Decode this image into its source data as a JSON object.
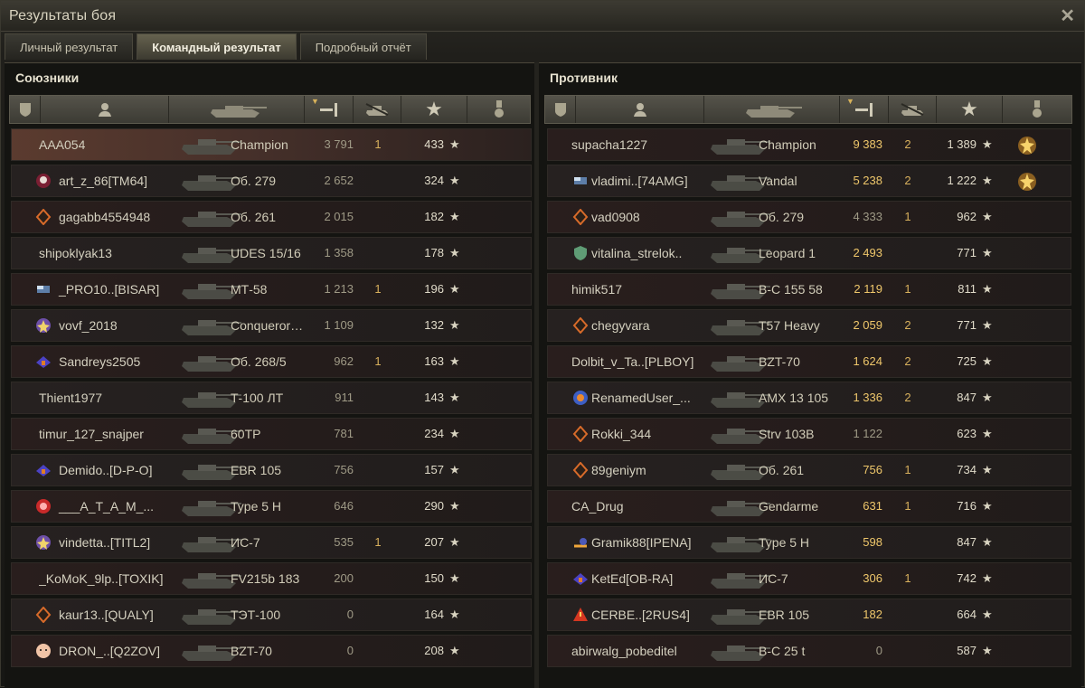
{
  "window": {
    "title": "Результаты боя",
    "close_label": "✕"
  },
  "tabs": [
    {
      "label": "Личный результат",
      "active": false
    },
    {
      "label": "Командный результат",
      "active": true
    },
    {
      "label": "Подробный отчёт",
      "active": false
    }
  ],
  "allies": {
    "title": "Союзники",
    "columns": [
      "clan-icon",
      "player-icon",
      "tank-icon",
      "damage-icon",
      "kills-icon",
      "experience-icon",
      "medal-icon"
    ],
    "rows": [
      {
        "name": "AAA054",
        "badge": "",
        "tank": "Champion",
        "damage": "3 791",
        "kills": "1",
        "exp": "433",
        "me": true
      },
      {
        "name": "art_z_86[TM64]",
        "badge": "skull-badge-icon",
        "tank": "Об. 279",
        "damage": "2 652",
        "kills": "",
        "exp": "324"
      },
      {
        "name": "gagabb4554948",
        "badge": "diamond-badge-icon",
        "tank": "Об. 261",
        "damage": "2 015",
        "kills": "",
        "exp": "182"
      },
      {
        "name": "shipoklyak13",
        "badge": "",
        "tank": "UDES 15/16",
        "damage": "1 358",
        "kills": "",
        "exp": "178"
      },
      {
        "name": "_PRO10..[BISAR]",
        "badge": "flag-badge-icon",
        "tank": "МТ-58",
        "damage": "1 213",
        "kills": "1",
        "exp": "196"
      },
      {
        "name": "vovf_2018",
        "badge": "star-badge-icon",
        "tank": "Conqueror…",
        "damage": "1 109",
        "kills": "",
        "exp": "132"
      },
      {
        "name": "Sandreys2505",
        "badge": "wing-badge-icon",
        "tank": "Об. 268/5",
        "damage": "962",
        "kills": "1",
        "exp": "163"
      },
      {
        "name": "Thient1977",
        "badge": "",
        "tank": "Т-100 ЛТ",
        "damage": "911",
        "kills": "",
        "exp": "143"
      },
      {
        "name": "timur_127_snajper",
        "badge": "",
        "tank": "60TP",
        "damage": "781",
        "kills": "",
        "exp": "234"
      },
      {
        "name": "Demido..[D-P-O]",
        "badge": "wing-badge-icon",
        "tank": "EBR 105",
        "damage": "756",
        "kills": "",
        "exp": "157"
      },
      {
        "name": "___A_T_A_M_...",
        "badge": "target-badge-icon",
        "tank": "Type 5 H",
        "damage": "646",
        "kills": "",
        "exp": "290"
      },
      {
        "name": "vindetta..[TITL2]",
        "badge": "star-badge-icon",
        "tank": "ИС-7",
        "damage": "535",
        "kills": "1",
        "exp": "207"
      },
      {
        "name": "_KoMoK_9lp..[TOXIK]",
        "badge": "",
        "tank": "FV215b 183",
        "damage": "200",
        "kills": "",
        "exp": "150"
      },
      {
        "name": "kaur13..[QUALY]",
        "badge": "diamond-badge-icon",
        "tank": "ТЭТ-100",
        "damage": "0",
        "kills": "",
        "exp": "164"
      },
      {
        "name": "DRON_..[Q2ZOV]",
        "badge": "face-badge-icon",
        "tank": "BZT-70",
        "damage": "0",
        "kills": "",
        "exp": "208"
      }
    ]
  },
  "enemies": {
    "title": "Противник",
    "rows": [
      {
        "name": "supacha1227",
        "badge": "",
        "tank": "Champion",
        "damage": "9 383",
        "kills": "2",
        "exp": "1 389",
        "medal": "gold-medal-icon"
      },
      {
        "name": "vladimi..[74AMG]",
        "badge": "flag-badge-icon",
        "tank": "Vandal",
        "damage": "5 238",
        "kills": "2",
        "exp": "1 222",
        "medal": "gold-medal-icon"
      },
      {
        "name": "vad0908",
        "badge": "diamond-badge-icon",
        "tank": "Об. 279",
        "damage": "4 333",
        "kills": "1",
        "exp": "962"
      },
      {
        "name": "vitalina_strelok..",
        "badge": "shield-badge-icon",
        "tank": "Leopard 1",
        "damage": "2 493",
        "kills": "",
        "exp": "771"
      },
      {
        "name": "himik517",
        "badge": "",
        "tank": "В-С 155 58",
        "damage": "2 119",
        "kills": "1",
        "exp": "811"
      },
      {
        "name": "chegyvara",
        "badge": "diamond-badge-icon",
        "tank": "T57 Heavy",
        "damage": "2 059",
        "kills": "2",
        "exp": "771"
      },
      {
        "name": "Dolbit_v_Ta..[PLBOY]",
        "badge": "",
        "tank": "BZT-70",
        "damage": "1 624",
        "kills": "2",
        "exp": "725"
      },
      {
        "name": "RenamedUser_...",
        "badge": "sun-badge-icon",
        "tank": "AMX 13 105",
        "damage": "1 336",
        "kills": "2",
        "exp": "847"
      },
      {
        "name": "Rokki_344",
        "badge": "diamond-badge-icon",
        "tank": "Strv 103B",
        "damage": "1 122",
        "kills": "",
        "exp": "623"
      },
      {
        "name": "89geniym",
        "badge": "diamond-badge-icon",
        "tank": "Об. 261",
        "damage": "756",
        "kills": "1",
        "exp": "734"
      },
      {
        "name": "CA_Drug",
        "badge": "",
        "tank": "Gendarme",
        "damage": "631",
        "kills": "1",
        "exp": "716"
      },
      {
        "name": "Gramik88[IPENA]",
        "badge": "speed-badge-icon",
        "tank": "Type 5 H",
        "damage": "598",
        "kills": "",
        "exp": "847"
      },
      {
        "name": "KetEd[OB-RA]",
        "badge": "wing-badge-icon",
        "tank": "ИС-7",
        "damage": "306",
        "kills": "1",
        "exp": "742"
      },
      {
        "name": "CERBE..[2RUS4]",
        "badge": "warning-badge-icon",
        "tank": "EBR 105",
        "damage": "182",
        "kills": "",
        "exp": "664"
      },
      {
        "name": "abirwalg_pobeditel",
        "badge": "",
        "tank": "В-С 25 t",
        "damage": "0",
        "kills": "",
        "exp": "587"
      }
    ]
  },
  "colors": {
    "gold": "#d7b05d",
    "highlight_row": "#5b3b2f",
    "text": "#d4d0bf"
  }
}
